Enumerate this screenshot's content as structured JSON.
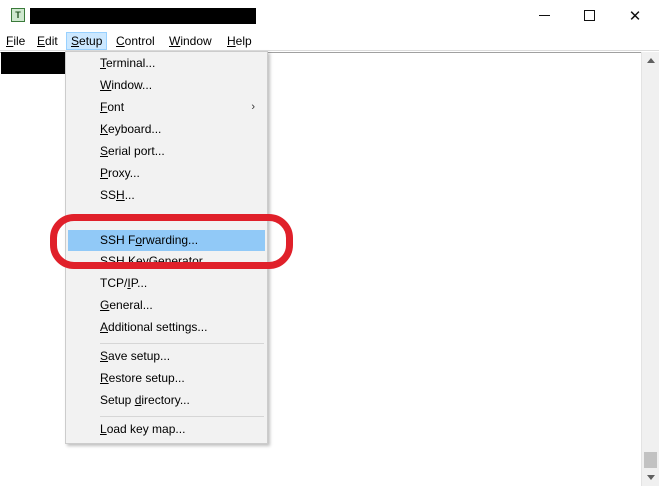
{
  "titlebar": {
    "app_icon_letter": "T",
    "title_redacted": true
  },
  "window_buttons": {
    "minimize_icon": "minimize-icon",
    "maximize_icon": "maximize-icon",
    "close_icon": "close-icon",
    "close_glyph": "✕"
  },
  "menubar": {
    "file": {
      "u": "F",
      "rest": "ile"
    },
    "edit": {
      "u": "E",
      "rest": "dit"
    },
    "setup": {
      "u": "S",
      "rest": "etup"
    },
    "control": {
      "u": "C",
      "rest": "ontrol"
    },
    "window": {
      "u": "W",
      "rest": "indow"
    },
    "help": {
      "u": "H",
      "rest": "elp"
    }
  },
  "setup_menu": {
    "terminal": {
      "u": "T",
      "rest": "erminal..."
    },
    "window": {
      "u": "W",
      "rest": "indow..."
    },
    "font": {
      "u": "F",
      "rest": "ont"
    },
    "font_arrow": "›",
    "keyboard": {
      "u": "K",
      "rest": "eyboard..."
    },
    "serial": {
      "u": "S",
      "rest": "erial port..."
    },
    "proxy": {
      "u": "P",
      "rest": "roxy..."
    },
    "ssh": {
      "pre": "SS",
      "u": "H",
      "rest": "..."
    },
    "ssh_auth_partial": "",
    "ssh_forwarding": {
      "pre": "SSH F",
      "u": "o",
      "rest": "rwarding..."
    },
    "ssh_keygen": {
      "pre": "SSH ",
      "u": "K",
      "rest": "eyGenerator..."
    },
    "tcpip": {
      "pre": "TCP/",
      "u": "I",
      "rest": "P..."
    },
    "general": {
      "u": "G",
      "rest": "eneral..."
    },
    "additional": {
      "u": "A",
      "rest": "dditional settings..."
    },
    "save_setup": {
      "u": "S",
      "rest": "ave setup..."
    },
    "restore_setup": {
      "u": "R",
      "rest": "estore setup..."
    },
    "setup_directory": {
      "pre": "Setup ",
      "u": "d",
      "rest": "irectory..."
    },
    "load_key_map": {
      "u": "L",
      "rest": "oad key map..."
    }
  },
  "colors": {
    "highlight": "#91c9f7",
    "annotation": "#e0202a",
    "menu_active": "#cce8ff"
  }
}
